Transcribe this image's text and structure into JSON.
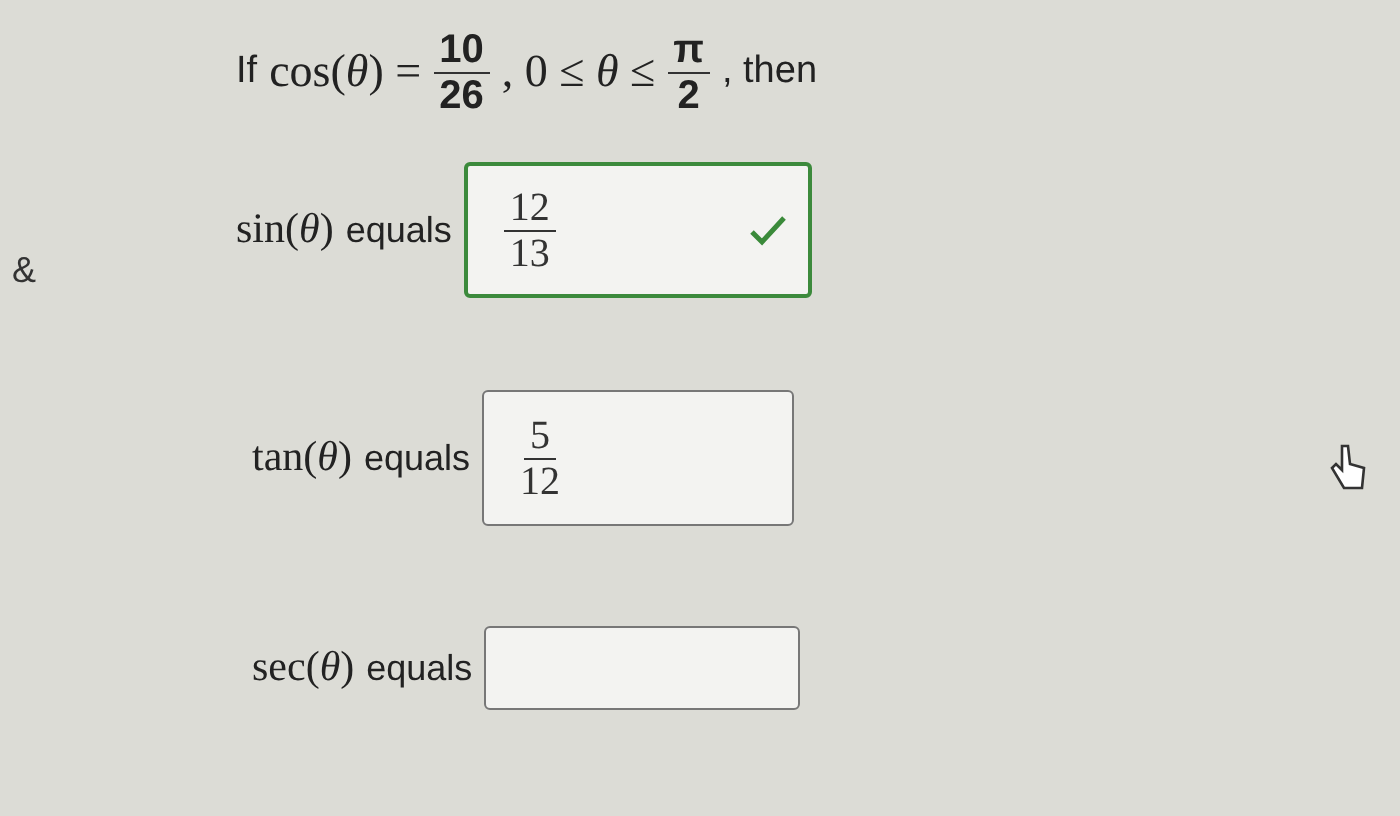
{
  "side_mark": "&",
  "question": [
    {
      "kind": "text",
      "text": "If"
    },
    {
      "kind": "math",
      "text": "cos(*θ*) ="
    },
    {
      "kind": "frac",
      "num": "10",
      "den": "26"
    },
    {
      "kind": "math",
      "text": ", 0 ≤ *θ* ≤"
    },
    {
      "kind": "frac",
      "num": "π",
      "den": "2"
    },
    {
      "kind": "text",
      "text": ", then"
    }
  ],
  "answers": [
    {
      "label": "sin(*θ*)",
      "word": "equals",
      "num": "12",
      "den": "13",
      "correct": true
    },
    {
      "label": "tan(*θ*)",
      "word": "equals",
      "num": "5",
      "den": "12",
      "correct": false
    },
    {
      "label": "sec(*θ*)",
      "word": "equals",
      "correct": false
    }
  ]
}
